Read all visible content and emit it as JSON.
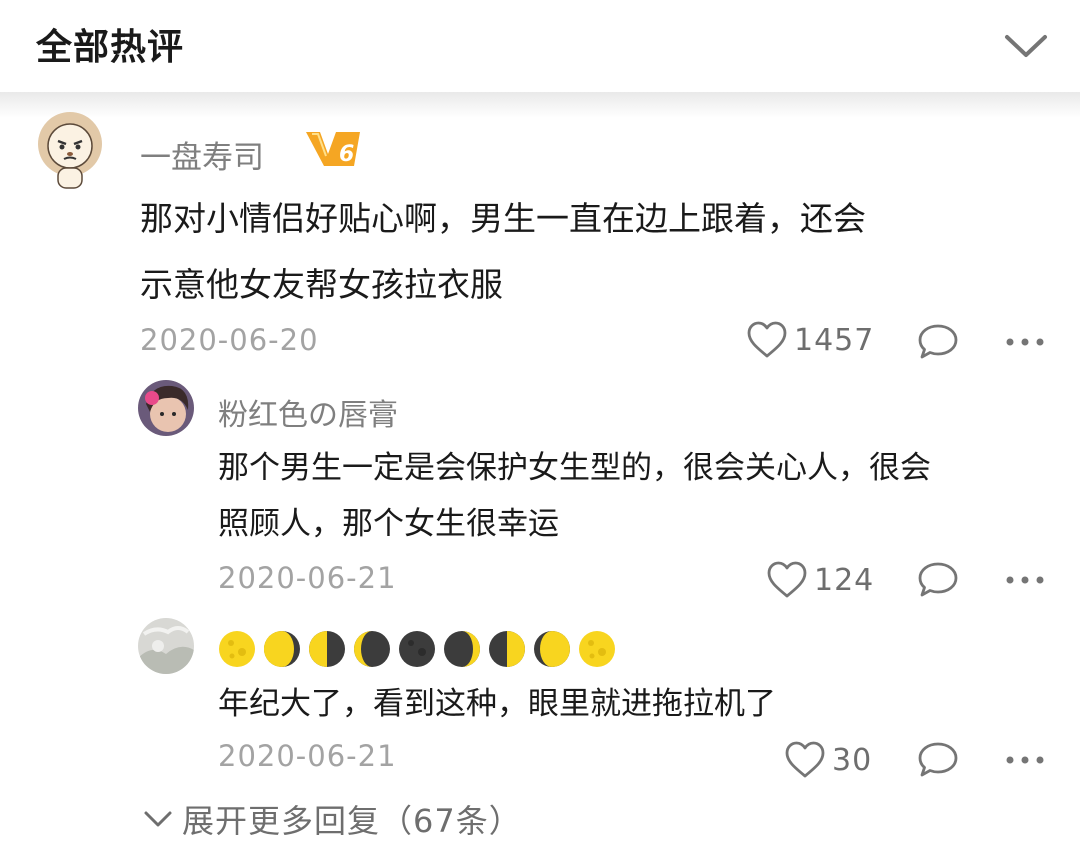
{
  "header": {
    "title": "全部热评"
  },
  "icons": {
    "collapse": "chevron-down-icon",
    "like": "heart-outline-icon",
    "reply": "speech-bubble-icon",
    "more": "more-dots-icon",
    "expand": "chevron-down-icon"
  },
  "main_comment": {
    "user": "一盘寿司",
    "vip_level": "6",
    "text_line1": "那对小情侣好贴心啊，男生一直在边上跟着，还会",
    "text_line2": "示意他女友帮女孩拉衣服",
    "date": "2020-06-20",
    "likes": "1457"
  },
  "replies": [
    {
      "user": "粉红色の唇膏",
      "text_line1": "那个男生一定是会保护女生型的，很会关心人，很会",
      "text_line2": "照顾人，那个女生很幸运",
      "date": "2020-06-21",
      "likes": "124"
    },
    {
      "user_emoji_phases": [
        "full",
        "waning-gibbous",
        "last-quarter",
        "waning-crescent",
        "new",
        "waxing-crescent",
        "first-quarter",
        "waxing-gibbous",
        "full"
      ],
      "text": "年纪大了，看到这种，眼里就进拖拉机了",
      "date": "2020-06-21",
      "likes": "30"
    }
  ],
  "expand_label": "展开更多回复（67条）",
  "colors": {
    "text_primary": "#1a1a1a",
    "text_secondary": "#7f7f7f",
    "text_muted": "#a3a3a3",
    "icon": "#757575",
    "vip_orange": "#f5a623",
    "moon_yellow": "#f8d51f",
    "moon_dark": "#3c3c3c"
  }
}
